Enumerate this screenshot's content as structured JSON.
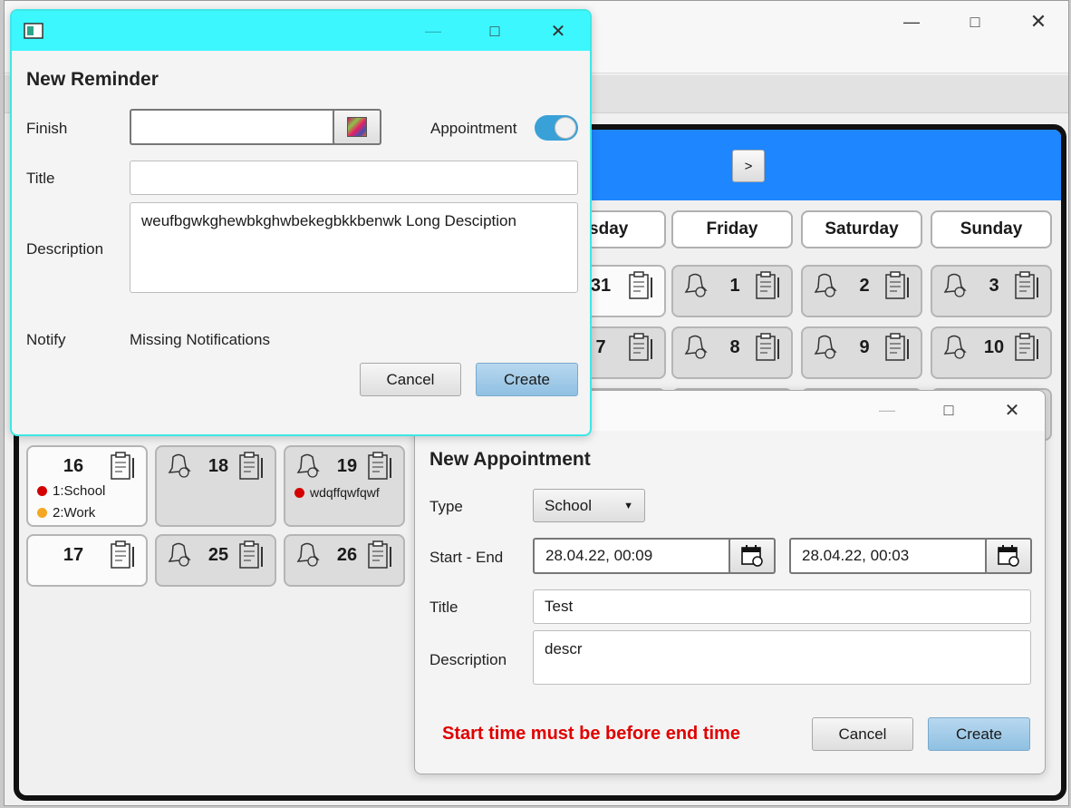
{
  "main": {
    "next_label": ">",
    "weekdays": [
      "rsday",
      "Friday",
      "Saturday",
      "Sunday"
    ],
    "week1": [
      "31",
      "1",
      "2",
      "3"
    ],
    "week2": [
      "7",
      "8",
      "9",
      "10"
    ],
    "left_days": [
      "16",
      "18",
      "19",
      "17",
      "25",
      "26"
    ],
    "events_16": [
      "1:School",
      "2:Work"
    ],
    "events_19": [
      "wdqffqwfqwf"
    ],
    "colors": {
      "header": "#1e86ff",
      "event_red": "#d40000",
      "event_orange": "#f5a623"
    }
  },
  "reminder": {
    "title": "New Reminder",
    "finish_label": "Finish",
    "finish_value": "",
    "appointment_label": "Appointment",
    "appointment_on": true,
    "title_label": "Title",
    "title_value": "",
    "description_label": "Description",
    "description_value": "weufbgwkghewbkghwbekegbkkbenwk Long Desciption",
    "notify_label": "Notify",
    "notify_value": "Missing Notifications",
    "cancel_label": "Cancel",
    "create_label": "Create",
    "titlebar_color": "#3df7ff"
  },
  "appointment": {
    "title": "New Appointment",
    "type_label": "Type",
    "type_value": "School",
    "start_end_label": "Start - End",
    "start_value": "28.04.22, 00:09",
    "end_value": "28.04.22, 00:03",
    "title_label": "Title",
    "title_value": "Test",
    "description_label": "Description",
    "description_value": "descr",
    "error": "Start time must be before end time",
    "cancel_label": "Cancel",
    "create_label": "Create",
    "error_color": "#e00000"
  }
}
